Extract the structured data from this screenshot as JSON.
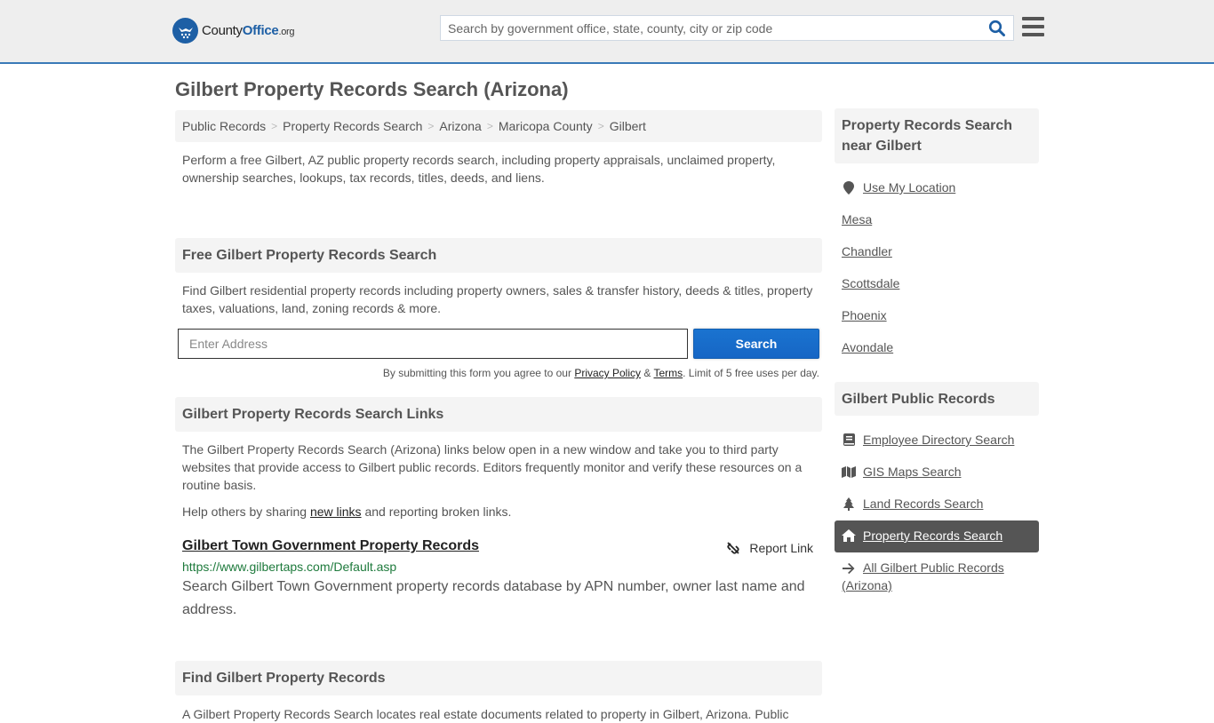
{
  "header": {
    "logo": {
      "county": "County",
      "office": "Office",
      "org": ".org"
    },
    "search_placeholder": "Search by government office, state, county, city or zip code"
  },
  "page_title": "Gilbert Property Records Search (Arizona)",
  "breadcrumb": [
    "Public Records",
    "Property Records Search",
    "Arizona",
    "Maricopa County",
    "Gilbert"
  ],
  "intro": "Perform a free Gilbert, AZ public property records search, including property appraisals, unclaimed property, ownership searches, lookups, tax records, titles, deeds, and liens.",
  "free_search": {
    "heading": "Free Gilbert Property Records Search",
    "description": "Find Gilbert residential property records including property owners, sales & transfer history, deeds & titles, property taxes, valuations, land, zoning records & more.",
    "address_placeholder": "Enter Address",
    "search_button": "Search",
    "disclaimer_pre": "By submitting this form you agree to our ",
    "privacy_link": "Privacy Policy",
    "amp": " & ",
    "terms_link": "Terms",
    "disclaimer_post": ". Limit of 5 free uses per day."
  },
  "links_section": {
    "heading": "Gilbert Property Records Search Links",
    "description": "The Gilbert Property Records Search (Arizona) links below open in a new window and take you to third party websites that provide access to Gilbert public records. Editors frequently monitor and verify these resources on a routine basis.",
    "help_pre": "Help others by sharing ",
    "help_link": "new links",
    "help_post": " and reporting broken links.",
    "entries": [
      {
        "title": "Gilbert Town Government Property Records",
        "report_label": "Report Link",
        "url": "https://www.gilbertaps.com/Default.asp",
        "description": "Search Gilbert Town Government property records database by APN number, owner last name and address."
      }
    ]
  },
  "find_section": {
    "heading": "Find Gilbert Property Records",
    "description": "A Gilbert Property Records Search locates real estate documents related to property in Gilbert, Arizona. Public"
  },
  "sidebar": {
    "nearby": {
      "heading": "Property Records Search near Gilbert",
      "use_location": "Use My Location",
      "cities": [
        "Mesa",
        "Chandler",
        "Scottsdale",
        "Phoenix",
        "Avondale"
      ]
    },
    "public_records": {
      "heading": "Gilbert Public Records",
      "items": [
        {
          "label": "Employee Directory Search",
          "icon": "book-icon"
        },
        {
          "label": "GIS Maps Search",
          "icon": "map-icon"
        },
        {
          "label": "Land Records Search",
          "icon": "tree-icon"
        },
        {
          "label": "Property Records Search",
          "icon": "home-icon",
          "active": true
        },
        {
          "label": "All Gilbert Public Records (Arizona)",
          "icon": "arrow-right-icon"
        }
      ]
    }
  },
  "colors": {
    "accent": "#1d5fa5",
    "button": "#1a73d0",
    "url_green": "#1e7a3c",
    "active_bg": "#555555"
  }
}
